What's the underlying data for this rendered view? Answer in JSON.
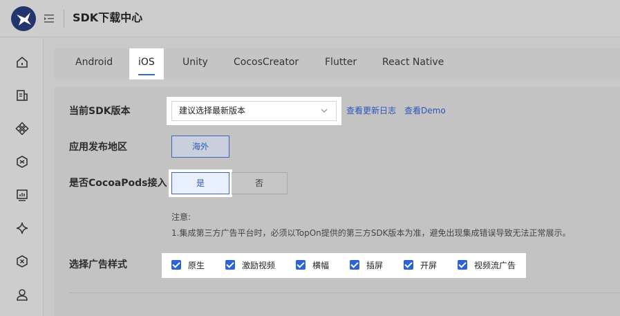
{
  "header": {
    "title": "SDK下载中心"
  },
  "sidebar": {
    "icons": [
      "home-icon",
      "document-icon",
      "grid-icon",
      "hexagon-icon",
      "chart-icon",
      "sparkle-icon",
      "cross-hexagon-icon",
      "user-icon"
    ]
  },
  "tabs": [
    {
      "label": "Android",
      "active": false
    },
    {
      "label": "iOS",
      "active": true
    },
    {
      "label": "Unity",
      "active": false
    },
    {
      "label": "CocosCreator",
      "active": false
    },
    {
      "label": "Flutter",
      "active": false
    },
    {
      "label": "React Native",
      "active": false
    }
  ],
  "form": {
    "sdk_version_label": "当前SDK版本",
    "sdk_version_value": "建议选择最新版本",
    "changelog_link": "查看更新日志",
    "demo_link": "查看Demo",
    "region_label": "应用发布地区",
    "region_value": "海外",
    "cocoapods_label": "是否CocoaPods接入",
    "cocoapods_yes": "是",
    "cocoapods_no": "否",
    "note_title": "注意:",
    "note_text": "1.集成第三方广告平台时，必须以TopOn提供的第三方SDK版本为准，避免出现集成错误导致无法正常展示。",
    "ad_style_label": "选择广告样式",
    "ad_styles": [
      {
        "label": "原生",
        "checked": true
      },
      {
        "label": "激励视频",
        "checked": true
      },
      {
        "label": "横幅",
        "checked": true
      },
      {
        "label": "插屏",
        "checked": true
      },
      {
        "label": "开屏",
        "checked": true
      },
      {
        "label": "视频流广告",
        "checked": true
      }
    ]
  },
  "colors": {
    "accent": "#2f63d0",
    "link": "#2a56b8"
  }
}
